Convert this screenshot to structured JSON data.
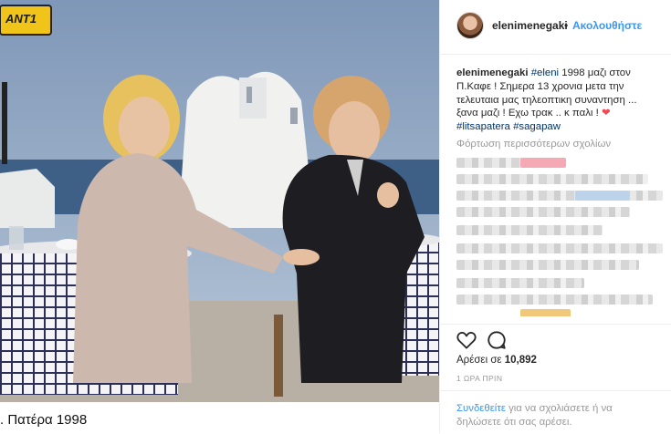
{
  "media": {
    "channel_logo": "ANT1",
    "caption_below": ". Πατέρα 1998"
  },
  "post": {
    "username": "elenimenegaki",
    "dot": "•",
    "follow_label": "Ακολουθήστε",
    "caption_user": "elenimenegaki",
    "caption_hashtag1": "#eleni",
    "caption_text": " 1998 μαζι στον Π.Καφε ! Σημερα 13 χρονια μετα την τελευταια μας τηλεοπτικη συναντηση ... ξανα μαζι ! Εχω τρακ .. κ παλι !",
    "caption_heart": "❤",
    "caption_hashtag2": "#litsapatera",
    "caption_hashtag3": "#sagapaw",
    "load_more": "Φόρτωση περισσότερων σχολίων",
    "likes_prefix": "Αρέσει σε ",
    "likes_count": "10,892",
    "time_ago": "1 ΩΡΑ ΠΡΙΝ",
    "login_link": "Συνδεθείτε",
    "login_text": " για να σχολιάσετε ή να δηλώσετε ότι σας αρέσει."
  },
  "icons": {
    "like": "heart-outline-icon",
    "comment": "comment-bubble-icon"
  },
  "colors": {
    "link_blue": "#3897f0",
    "hashtag": "#003569",
    "heart_red": "#ed4956",
    "muted": "#999999"
  }
}
